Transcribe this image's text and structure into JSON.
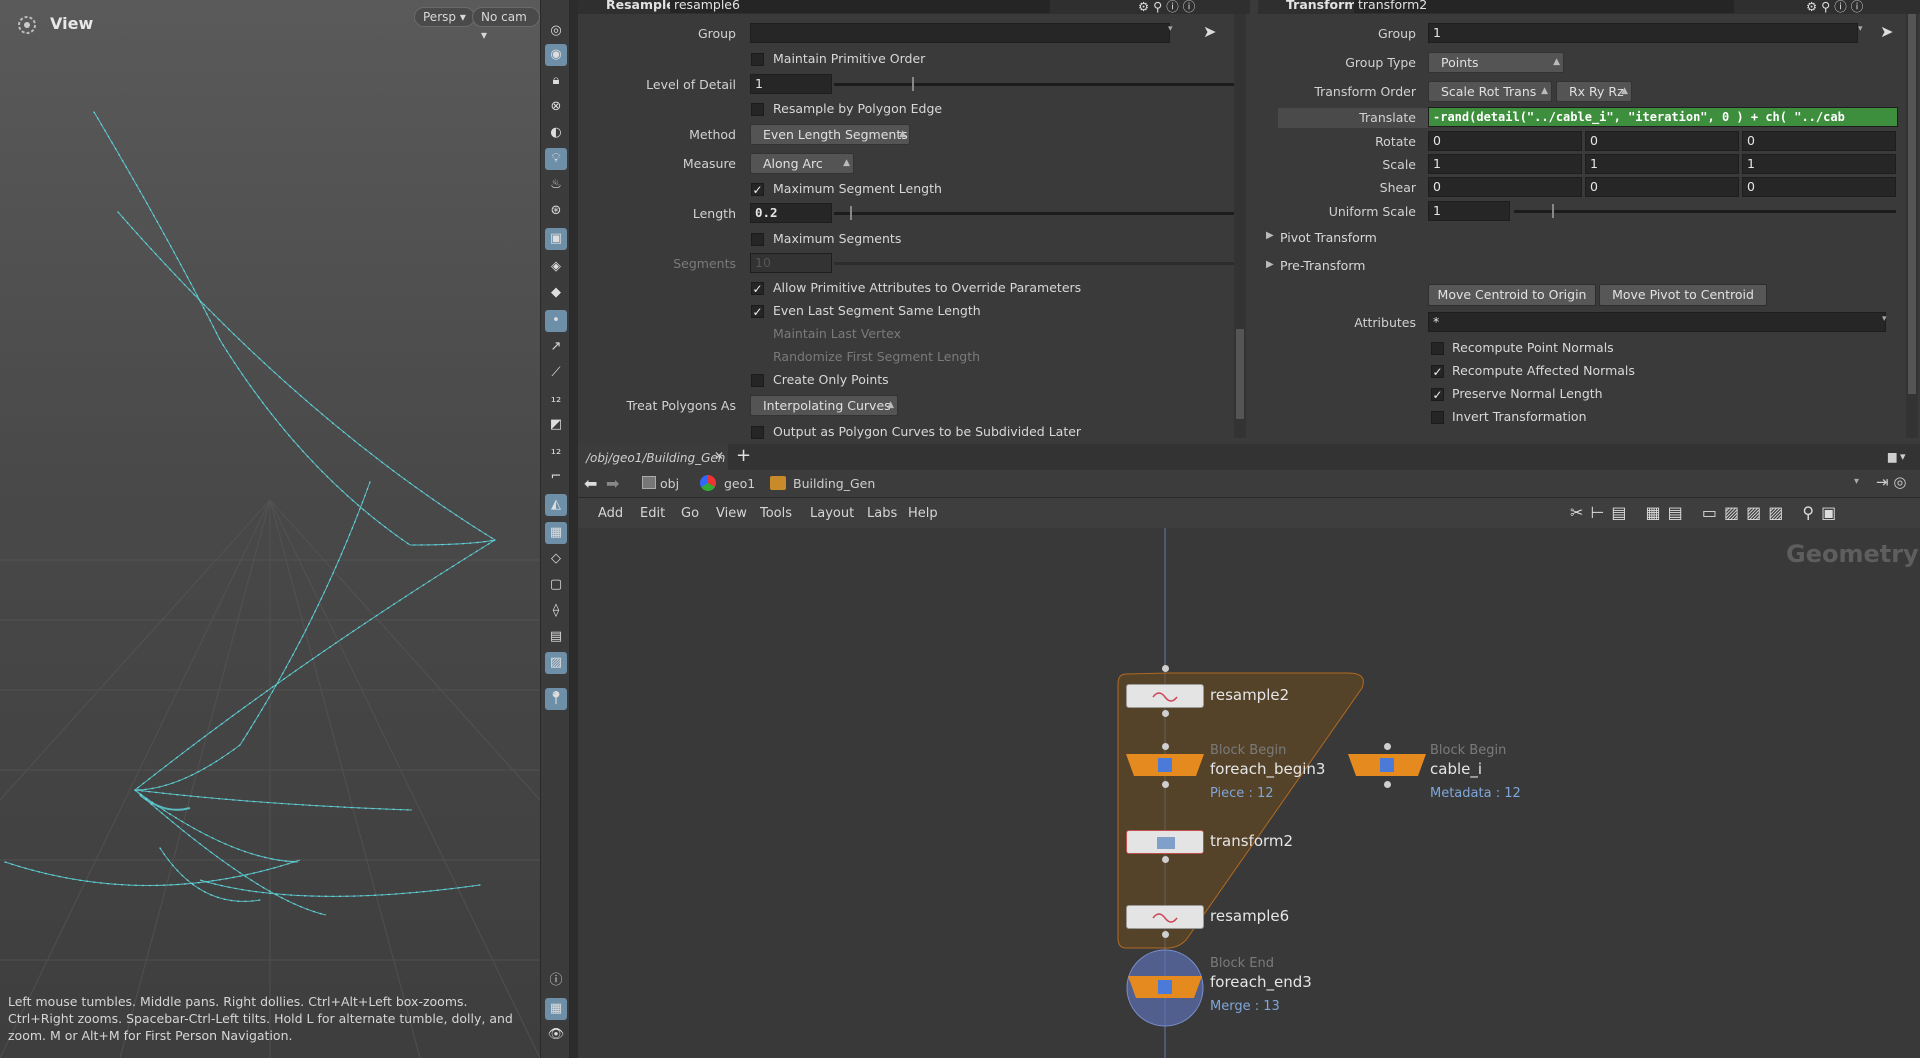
{
  "viewport": {
    "title": "View",
    "persp": "Persp",
    "cam": "No cam",
    "help": "Left mouse tumbles. Middle pans. Right dollies. Ctrl+Alt+Left box-zooms. Ctrl+Right zooms. Spacebar-Ctrl-Left tilts. Hold L for alternate tumble, dolly, and zoom. M or Alt+M for First Person Navigation."
  },
  "resample": {
    "type": "Resample",
    "name": "resample6",
    "group_label": "Group",
    "group_value": "",
    "maintain_order": "Maintain Primitive Order",
    "lod_label": "Level of Detail",
    "lod_value": "1",
    "by_edge": "Resample by Polygon Edge",
    "method_label": "Method",
    "method_value": "Even Length Segments",
    "measure_label": "Measure",
    "measure_value": "Along Arc",
    "max_seg_len": "Maximum Segment Length",
    "length_label": "Length",
    "length_value": "0.2",
    "max_segs": "Maximum Segments",
    "segments_label": "Segments",
    "segments_value": "10",
    "allow_prim": "Allow Primitive Attributes to Override Parameters",
    "even_last": "Even Last Segment Same Length",
    "maintain_last": "Maintain Last Vertex",
    "randomize_first": "Randomize First Segment Length",
    "create_points": "Create Only Points",
    "treat_label": "Treat Polygons As",
    "treat_value": "Interpolating Curves",
    "output_curves": "Output as Polygon Curves to be Subdivided Later"
  },
  "transform": {
    "type": "Transform",
    "name": "transform2",
    "group_label": "Group",
    "group_value": "1",
    "gtype_label": "Group Type",
    "gtype_value": "Points",
    "order_label": "Transform Order",
    "order_value": "Scale Rot Trans",
    "rot_order": "Rx Ry Rz",
    "translate_label": "Translate",
    "translate_expr": "-rand(detail(\"../cable_i\", \"iteration\", 0 ) + ch( \"../cab",
    "rotate_label": "Rotate",
    "rotate": [
      "0",
      "0",
      "0"
    ],
    "scale_label": "Scale",
    "scale": [
      "1",
      "1",
      "1"
    ],
    "shear_label": "Shear",
    "shear": [
      "0",
      "0",
      "0"
    ],
    "uscale_label": "Uniform Scale",
    "uscale_value": "1",
    "pivot": "Pivot Transform",
    "pre": "Pre-Transform",
    "move_centroid": "Move Centroid to Origin",
    "move_pivot": "Move Pivot to Centroid",
    "attr_label": "Attributes",
    "attr_value": "*",
    "recompute_point": "Recompute Point Normals",
    "recompute_aff": "Recompute Affected Normals",
    "preserve": "Preserve Normal Length",
    "invert": "Invert Transformation"
  },
  "network": {
    "tab": "/obj/geo1/Building_Gen",
    "path": [
      "obj",
      "geo1",
      "Building_Gen"
    ],
    "menu": [
      "Add",
      "Edit",
      "Go",
      "View",
      "Tools",
      "Layout",
      "Labs",
      "Help"
    ],
    "context": "Geometry",
    "nodes": {
      "resample2": "resample2",
      "begin_head": "Block Begin",
      "begin_name": "foreach_begin3",
      "begin_sub": "Piece : 12",
      "cable_head": "Block Begin",
      "cable_name": "cable_i",
      "cable_sub": "Metadata : 12",
      "transform": "transform2",
      "resample6": "resample6",
      "end_head": "Block End",
      "end_name": "foreach_end3",
      "end_sub": "Merge : 13"
    }
  },
  "colors": {
    "accent": "#6d8fa8",
    "curve": "#5fd7de",
    "block": "#e58a1f",
    "expr_bg": "#3d8f3d"
  }
}
